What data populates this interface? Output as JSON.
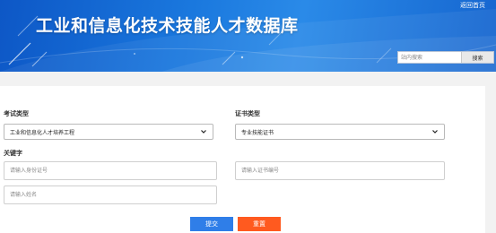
{
  "header": {
    "title": "工业和信息化技术技能人才数据库",
    "home_link": "返回首页",
    "search": {
      "placeholder": "站内搜索",
      "button_label": "搜索"
    }
  },
  "form": {
    "exam_type": {
      "label": "考试类型",
      "selected": "工业和信息化人才培养工程"
    },
    "cert_type": {
      "label": "证书类型",
      "selected": "专业技能证书"
    },
    "keyword": {
      "label": "关键字",
      "id_placeholder": "请输入身份证号",
      "cert_no_placeholder": "请输入证书编号",
      "name_placeholder": "请输入姓名"
    },
    "submit_label": "提交",
    "reset_label": "重置"
  },
  "colors": {
    "banner_blue": "#1a78de",
    "submit_blue": "#2f7ee8",
    "reset_orange": "#ff5a1f"
  }
}
